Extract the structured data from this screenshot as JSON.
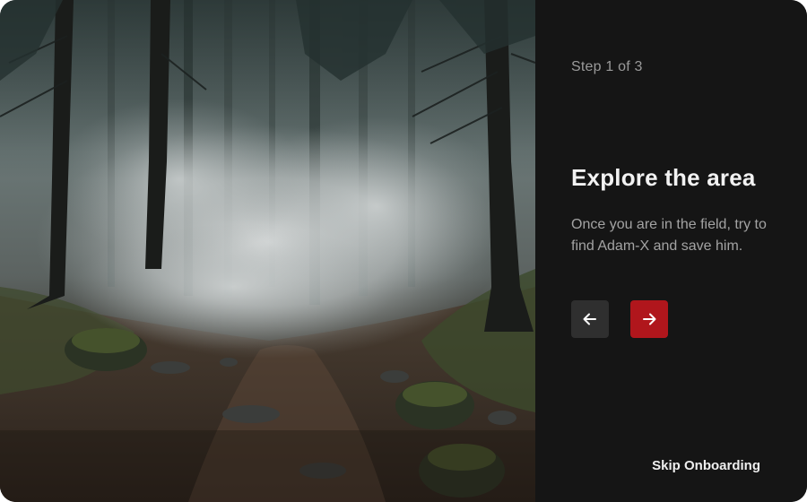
{
  "onboarding": {
    "step_label": "Step 1 of 3",
    "title": "Explore the area",
    "description": "Once you are in the field, try to find Adam-X and save him.",
    "skip_label": "Skip Onboarding"
  },
  "icons": {
    "prev": "arrow-left-icon",
    "next": "arrow-right-icon"
  },
  "colors": {
    "panel_background": "#151515",
    "next_button": "#b0161c",
    "prev_button": "#2f2f2f"
  }
}
